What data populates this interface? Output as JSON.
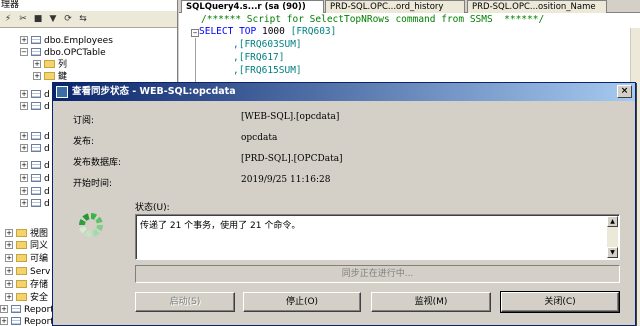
{
  "explorer": {
    "title": "理器",
    "tree": [
      {
        "label": "dbo.Employees",
        "icon": "table-icon",
        "expander": "+"
      },
      {
        "label": "dbo.OPCTable",
        "icon": "table-icon",
        "expander": "−"
      },
      {
        "label": "列",
        "icon": "folder-icon",
        "expander": "+"
      },
      {
        "label": "鍵",
        "icon": "folder-icon",
        "expander": "+"
      },
      {
        "label": "d",
        "icon": "table-icon",
        "expander": "+"
      },
      {
        "label": "d",
        "icon": "table-icon",
        "expander": "+"
      },
      {
        "label": "d",
        "icon": "table-icon",
        "expander": "+"
      },
      {
        "label": "d",
        "icon": "table-icon",
        "expander": "+"
      },
      {
        "label": "d",
        "icon": "table-icon",
        "expander": "+"
      },
      {
        "label": "d",
        "icon": "table-icon",
        "expander": "+"
      },
      {
        "label": "d",
        "icon": "table-icon",
        "expander": "+"
      },
      {
        "label": "d",
        "icon": "table-icon",
        "expander": "+"
      },
      {
        "label": "視图",
        "icon": "folder-icon",
        "expander": "+"
      },
      {
        "label": "同义",
        "icon": "folder-icon",
        "expander": "+"
      },
      {
        "label": "可编",
        "icon": "folder-icon",
        "expander": "+"
      },
      {
        "label": "Serv",
        "icon": "folder-icon",
        "expander": "+"
      },
      {
        "label": "存储",
        "icon": "folder-icon",
        "expander": "+"
      },
      {
        "label": "安全",
        "icon": "folder-icon",
        "expander": "+"
      },
      {
        "label": "ReportSe",
        "icon": "table-icon",
        "expander": "+"
      },
      {
        "label": "ReportSe",
        "icon": "table-icon",
        "expander": "+"
      }
    ]
  },
  "editor": {
    "tabs": [
      {
        "label": "SQLQuery4.s...r (sa (90))",
        "active": true
      },
      {
        "label": "PRD-SQL.OPC...ord_history",
        "active": false
      },
      {
        "label": "PRD-SQL.OPC...osition_Name",
        "active": false
      }
    ],
    "comment_line": "/****** Script for SelectTopNRows command from SSMS  ******/",
    "select_kw": "SELECT",
    "top_kw": "TOP",
    "top_value": "1000",
    "first_column": "[FRQ603]",
    "columns": [
      ",[FRQ603SUM]",
      ",[FRQ617]",
      ",[FRQ615SUM]"
    ]
  },
  "dialog": {
    "title": "查看同步状态 - WEB-SQL:opcdata",
    "close_glyph": "×",
    "fields": [
      {
        "label": "订阅:",
        "value": "[WEB-SQL].[opcdata]"
      },
      {
        "label": "发布:",
        "value": "opcdata"
      },
      {
        "label": "发布数据库:",
        "value": "[PRD-SQL].[OPCData]"
      },
      {
        "label": "开始时间:",
        "value": "2019/9/25 11:16:28"
      }
    ],
    "status_label": "状态(U):",
    "status_text": "传递了 21 个事务，使用了 21 个命令。",
    "progress_text": "同步正在进行中...",
    "buttons": {
      "start": "启动(S)",
      "stop": "停止(O)",
      "monitor": "监视(M)",
      "close": "关闭(C)"
    }
  }
}
